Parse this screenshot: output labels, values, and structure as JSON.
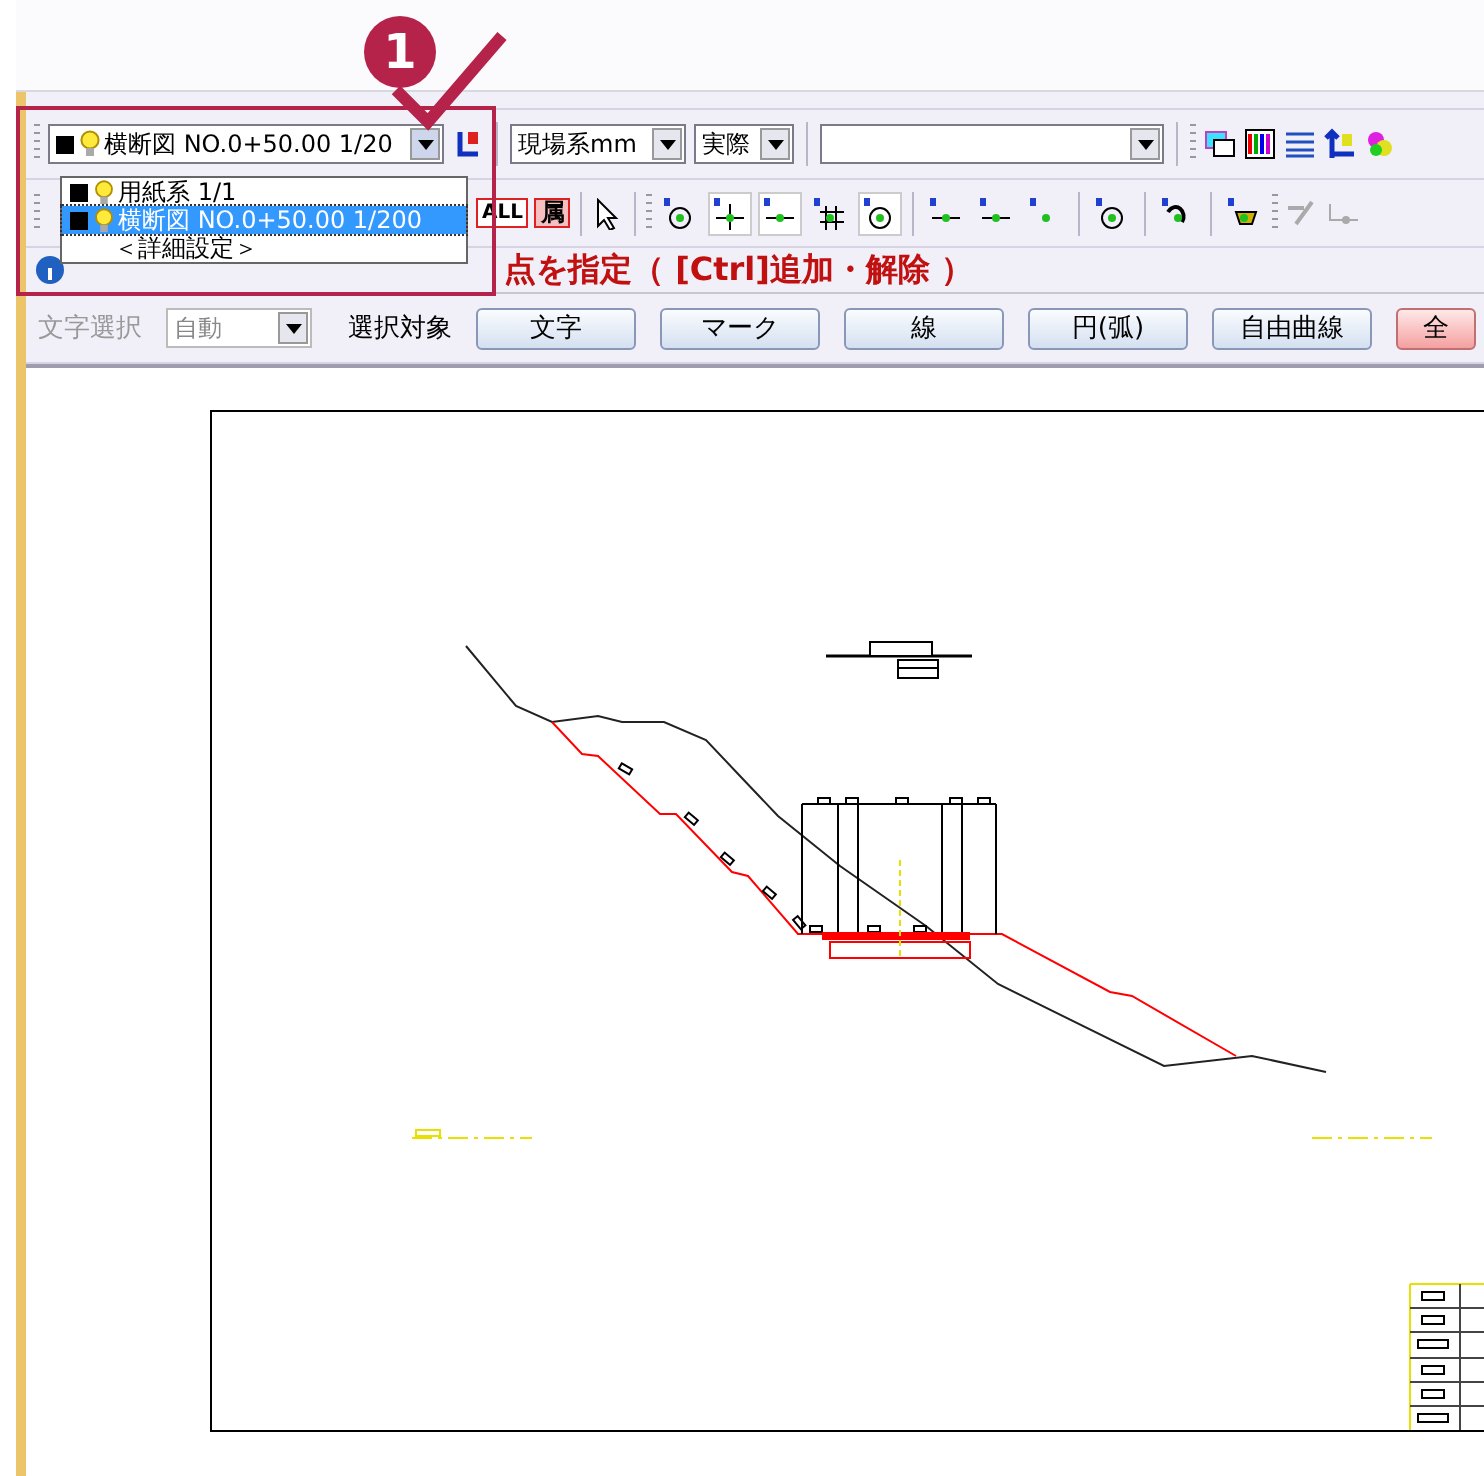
{
  "annotation": {
    "number": "1"
  },
  "layer_select": {
    "value": "横断図 NO.0+50.00 1/20",
    "expanded": true,
    "options": [
      {
        "label": "用紙系 1/1",
        "selected": false,
        "kind": "layer"
      },
      {
        "label": "横断図 NO.0+50.00 1/200",
        "selected": true,
        "kind": "layer"
      },
      {
        "label": "＜詳細設定＞",
        "selected": false,
        "kind": "setting"
      }
    ]
  },
  "coord_select": {
    "value": "現場系mm"
  },
  "scale_select": {
    "value": "実際"
  },
  "tool_labels": [
    "ALL",
    "属"
  ],
  "status_message": "点を指定（ [Ctrl]追加・解除 ）",
  "filter_bar": {
    "text_select_label": "文字選択",
    "text_select_value": "自動",
    "disabled": true,
    "target_label": "選択対象",
    "buttons": [
      {
        "label": "文字",
        "highlighted": false
      },
      {
        "label": "マーク",
        "highlighted": false
      },
      {
        "label": "線",
        "highlighted": false
      },
      {
        "label": "円(弧)",
        "highlighted": false
      },
      {
        "label": "自由曲線",
        "highlighted": false
      },
      {
        "label": "全",
        "highlighted": true
      }
    ]
  }
}
